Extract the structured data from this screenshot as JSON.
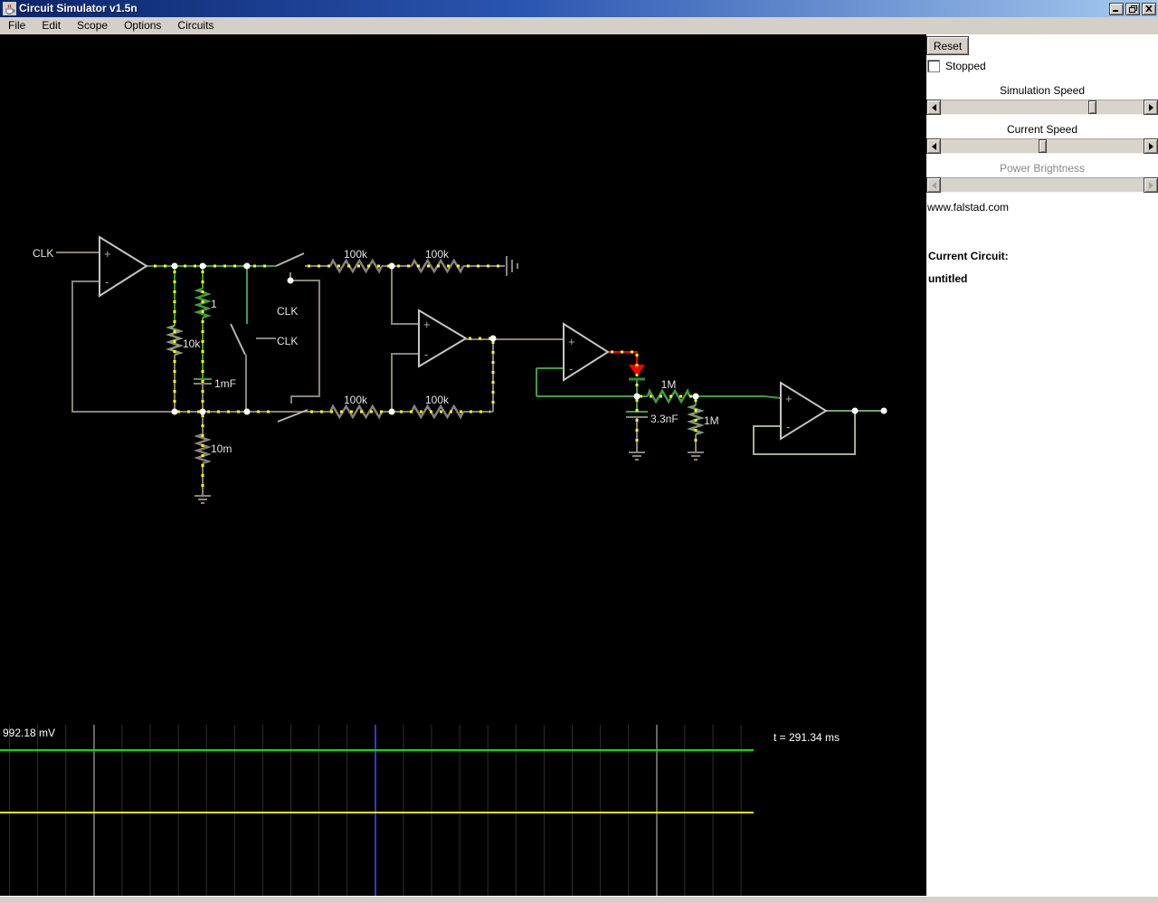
{
  "window": {
    "title": "Circuit Simulator v1.5n"
  },
  "menu": {
    "items": [
      "File",
      "Edit",
      "Scope",
      "Options",
      "Circuits"
    ]
  },
  "sidebar": {
    "reset_label": "Reset",
    "stopped_label": "Stopped",
    "stopped_checked": false,
    "sliders": [
      {
        "label": "Simulation Speed",
        "enabled": true,
        "thumb_pos": 0.76
      },
      {
        "label": "Current Speed",
        "enabled": true,
        "thumb_pos": 0.5
      },
      {
        "label": "Power Brightness",
        "enabled": false,
        "thumb_pos": 0
      }
    ],
    "link": "www.falstad.com",
    "current_circuit_label": "Current Circuit:",
    "circuit_name": "untitled"
  },
  "circuit": {
    "labels": {
      "clk_in": "CLK",
      "sw_top": "CLK",
      "sw_mid": "CLK",
      "r_unit": "1",
      "r_10k": "10k",
      "c_1mf": "1mF",
      "r_10m": "10m",
      "r_100k_a": "100k",
      "r_100k_b": "100k",
      "r_100k_c": "100k",
      "r_100k_d": "100k",
      "r_1m_h": "1M",
      "r_1m_v": "1M",
      "c_33nf": "3.3nF"
    },
    "opamp": {
      "plus": "+",
      "minus": "-"
    },
    "colors": {
      "wire_gray": "#8a817b",
      "wire_green": "#3f9e3f",
      "wire_red": "#ff0000",
      "current_dot": "#ffff00",
      "node": "#ffffff"
    }
  },
  "scope": {
    "voltage_readout": "992.18 mV",
    "time_readout": "t = 291.34 ms",
    "trace1_color": "#00e400",
    "trace2_color": "#e8e800",
    "marker_blue": "#3237d0",
    "marker_white": "#c0c0c0"
  }
}
